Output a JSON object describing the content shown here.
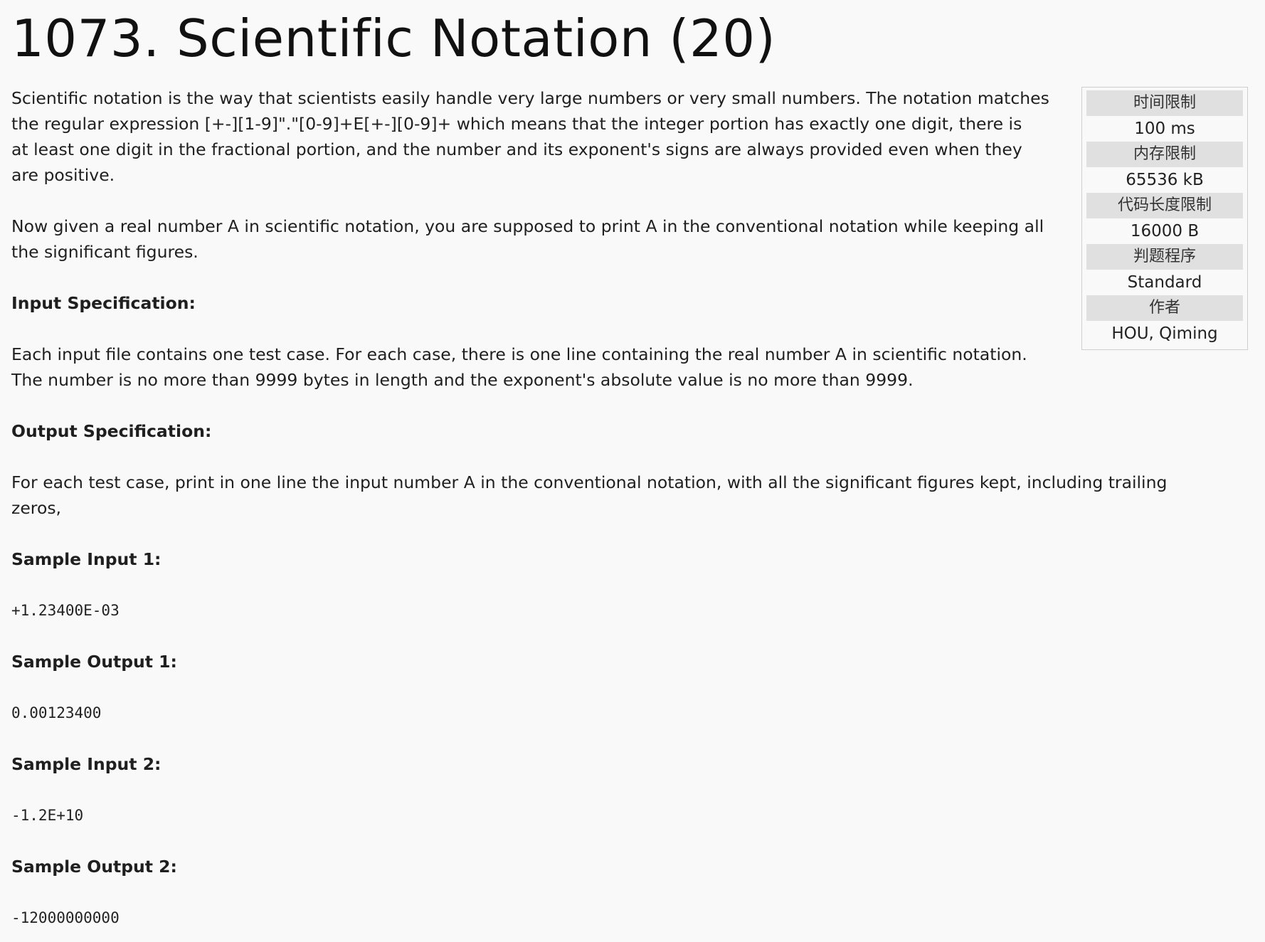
{
  "problem": {
    "title": "1073. Scientific Notation (20)"
  },
  "limits": [
    {
      "label": "时间限制",
      "value": "100 ms"
    },
    {
      "label": "内存限制",
      "value": "65536 kB"
    },
    {
      "label": "代码长度限制",
      "value": "16000 B"
    },
    {
      "label": "判题程序",
      "value": "Standard"
    },
    {
      "label": "作者",
      "value": "HOU, Qiming"
    }
  ],
  "description": {
    "p1_line1": "Scientific notation is the way that scientists easily handle very large numbers or very small numbers. The notation matches",
    "p1_line2": "the regular expression [+-][1-9]\".\"[0-9]+E[+-][0-9]+ which means that the integer portion has exactly one digit, there is",
    "p1_line3": "at least one digit in the fractional portion, and the number and its exponent's signs are always provided even when they",
    "p1_line4": "are positive.",
    "p2_line1": "Now given a real number A in scientific notation, you are supposed to print A in the conventional notation while keeping all",
    "p2_line2": "the significant figures."
  },
  "input_spec": {
    "heading": "Input Specification:",
    "line1": "Each input file contains one test case. For each case, there is one line containing the real number A in scientific notation.",
    "line2": "The number is no more than 9999 bytes in length and the exponent's absolute value is no more than 9999."
  },
  "output_spec": {
    "heading": "Output Specification:",
    "line1": "For each test case, print in one line the input number A in the conventional notation, with all the significant figures kept, including trailing",
    "line2": "zeros,"
  },
  "samples": [
    {
      "heading": "Sample Input 1:",
      "code": "+1.23400E-03"
    },
    {
      "heading": "Sample Output 1:",
      "code": "0.00123400"
    },
    {
      "heading": "Sample Input 2:",
      "code": "-1.2E+10"
    },
    {
      "heading": "Sample Output 2:",
      "code": "-12000000000"
    }
  ]
}
